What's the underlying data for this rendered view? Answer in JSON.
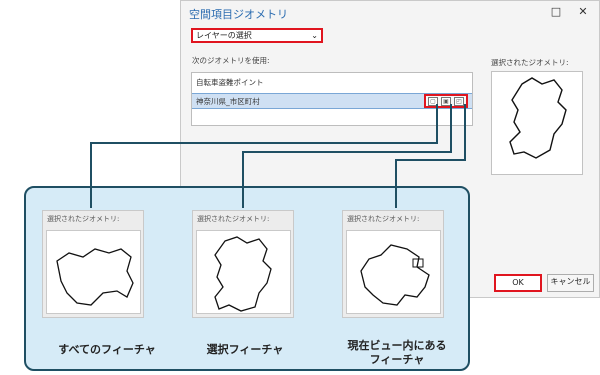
{
  "dialog": {
    "title": "空間項目ジオメトリ",
    "minimize_icon": "minimize-icon",
    "close_icon": "close-icon",
    "layer_select": {
      "value": "レイヤーの選択"
    },
    "next_geometry_label": "次のジオメトリを使用:",
    "list": [
      {
        "label": "自転車盗難ポイント"
      },
      {
        "label": "神奈川県_市区町村"
      }
    ],
    "geometry_buttons": [
      "all-features-icon",
      "selected-features-icon",
      "features-in-view-icon"
    ],
    "selected_geometry_label": "選択されたジオメトリ:",
    "ok_label": "OK",
    "cancel_label": "キャンセル"
  },
  "callout": {
    "cards": [
      {
        "label": "選択されたジオメトリ:",
        "caption": "すべてのフィーチャ"
      },
      {
        "label": "選択されたジオメトリ:",
        "caption": "選択フィーチャ"
      },
      {
        "label": "選択されたジオメトリ:",
        "caption": "現在ビュー内にある",
        "caption2": "フィーチャ"
      }
    ]
  },
  "colors": {
    "highlight_red": "#e0151f",
    "connector": "#1f4f63",
    "callout_bg": "#d6ebf7",
    "title_blue": "#2b6cb0"
  }
}
